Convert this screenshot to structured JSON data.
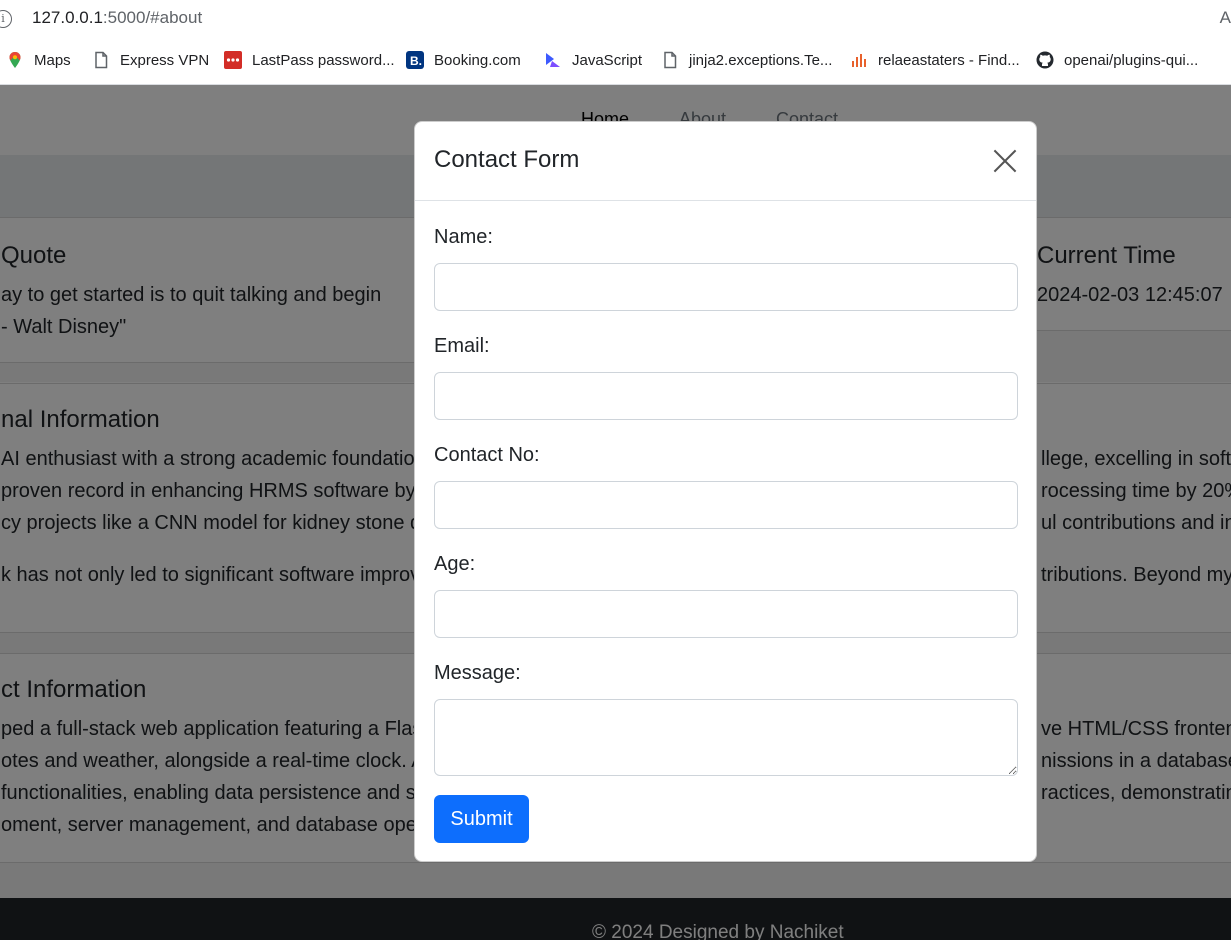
{
  "browser": {
    "url_host": "127.0.0.1",
    "url_rest": ":5000/#about",
    "right_edge_text": "A",
    "bookmarks": [
      {
        "label": "Maps",
        "icon": "maps-pin-icon"
      },
      {
        "label": "Express VPN",
        "icon": "page-icon"
      },
      {
        "label": "LastPass password...",
        "icon": "lastpass-icon"
      },
      {
        "label": "Booking.com",
        "icon": "booking-icon"
      },
      {
        "label": "JavaScript",
        "icon": "javascript-icon"
      },
      {
        "label": "jinja2.exceptions.Te...",
        "icon": "page-icon"
      },
      {
        "label": "relaeastaters - Find...",
        "icon": "chart-icon"
      },
      {
        "label": "openai/plugins-qui...",
        "icon": "github-icon"
      }
    ]
  },
  "page": {
    "nav": [
      "Home",
      "About",
      "Contact"
    ],
    "quote": {
      "heading": "Quote",
      "line1": "ay to get started is to quit talking and begin",
      "line2": "- Walt Disney\""
    },
    "time": {
      "heading": "Current Time",
      "value": "2024-02-03 12:45:07"
    },
    "personal": {
      "heading": "nal Information",
      "left_lines": [
        "AI enthusiast with a strong academic foundatio",
        "proven record in enhancing HRMS software by",
        "cy projects like a CNN model for kidney stone d",
        "k has not only led to significant software improv"
      ],
      "right_lines": [
        "llege, excelling in softw",
        "rocessing time by 20%",
        "ul contributions and inn",
        "tributions. Beyond my"
      ]
    },
    "project": {
      "heading": "ct Information",
      "left_lines": [
        "ped a full-stack web application featuring a Flas",
        "otes and weather, alongside a real-time clock. A",
        "functionalities, enabling data persistence and s",
        "oment, server management, and database oper"
      ],
      "right_lines": [
        "ve HTML/CSS fronten",
        "nissions in a database",
        "ractices, demonstratin",
        ""
      ]
    },
    "footer": "© 2024 Designed by Nachiket"
  },
  "modal": {
    "title": "Contact Form",
    "fields": [
      {
        "label": "Name:",
        "value": ""
      },
      {
        "label": "Email:",
        "value": ""
      },
      {
        "label": "Contact No:",
        "value": ""
      },
      {
        "label": "Age:",
        "value": ""
      },
      {
        "label": "Message:",
        "value": ""
      }
    ],
    "submit_label": "Submit"
  },
  "colors": {
    "primary": "#0d6efd",
    "footer": "#212529",
    "backdrop": "rgba(0,0,0,0.5)"
  }
}
